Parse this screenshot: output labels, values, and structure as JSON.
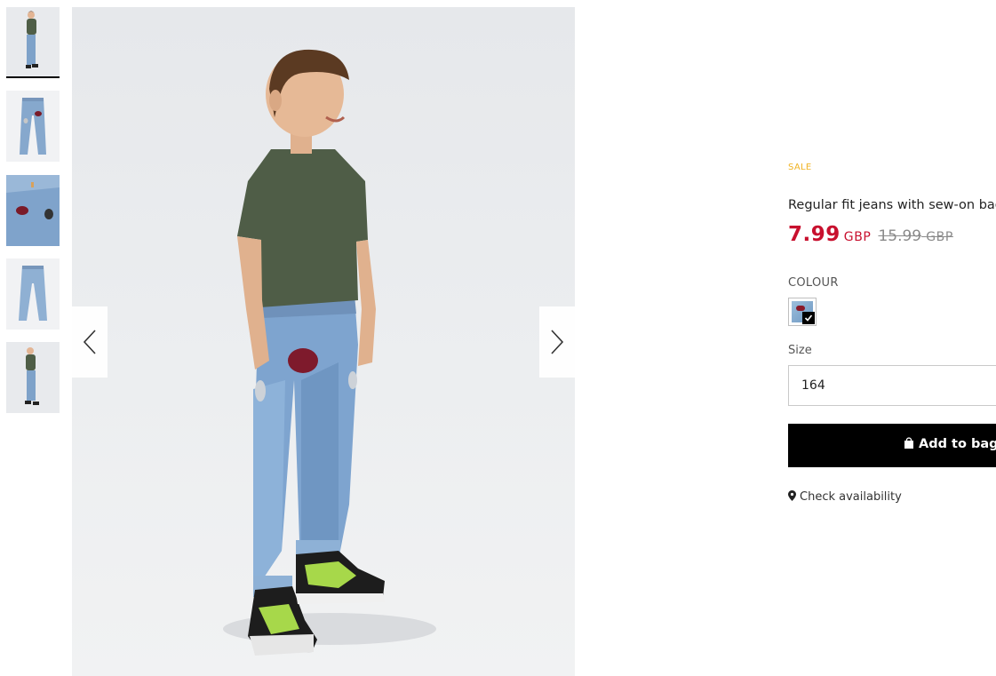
{
  "gallery": {
    "thumbnails": [
      {
        "label": "kid-full-front",
        "active": true
      },
      {
        "label": "jeans-flat-front",
        "active": false
      },
      {
        "label": "jeans-detail",
        "active": false
      },
      {
        "label": "jeans-flat-back",
        "active": false
      },
      {
        "label": "kid-full-side",
        "active": false
      }
    ],
    "prev_icon": "chevron-left-icon",
    "next_icon": "chevron-right-icon"
  },
  "product": {
    "badge": "SALE",
    "name": "Regular fit jeans with sew-on badges",
    "price": {
      "current": "7.99",
      "current_currency": "GBP",
      "old": "15.99",
      "old_currency": "GBP"
    },
    "colour_label": "COLOUR",
    "size_label": "Size",
    "size_value": "164",
    "add_to_bag_label": "Add to bag",
    "check_availability_label": "Check availability"
  },
  "colors": {
    "sale_badge": "#f0b323",
    "price_red": "#c8102e",
    "button_bg": "#000000"
  }
}
